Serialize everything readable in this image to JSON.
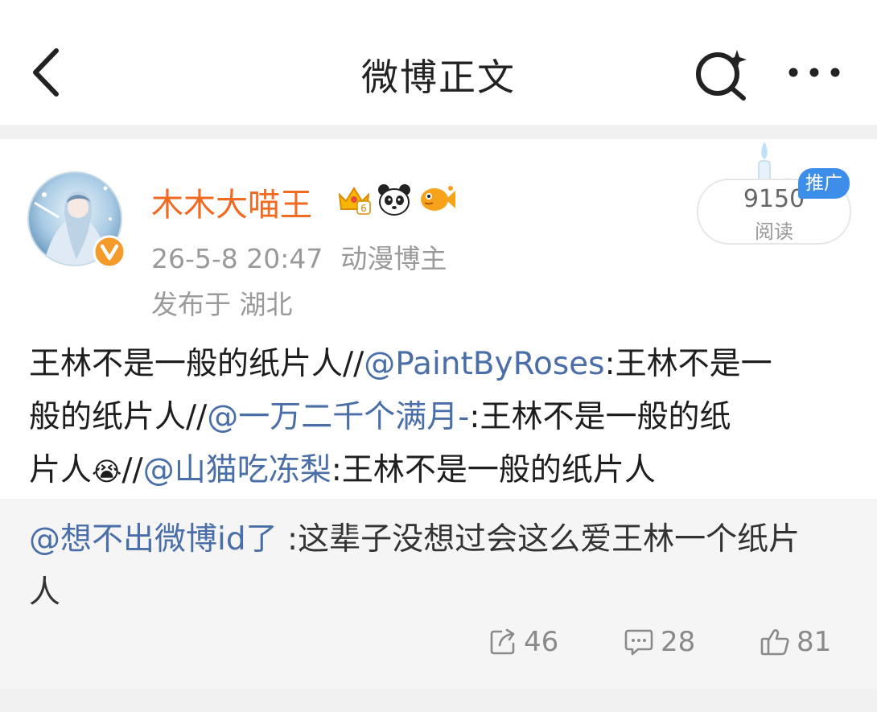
{
  "header": {
    "title": "微博正文"
  },
  "post": {
    "username": "木木大喵王",
    "datetime": "26-5-8 20:47",
    "source": "动漫博主",
    "location": "发布于 湖北",
    "read_count": "9150",
    "read_label": "阅读",
    "promo_badge": "推广",
    "badge_icons": [
      "crown-level-badge",
      "panda-badge",
      "fish-badge"
    ],
    "verified_icon": "verified-v-icon",
    "text": {
      "segment1": "王林不是一般的纸片人//",
      "mention1": "@PaintByRoses",
      "segment2a": ":王林不是一",
      "segment2b": "般的纸片人//",
      "mention2": "@一万二千个满月-",
      "segment3a": ":王林不是一般的纸",
      "segment3b": "片人",
      "emoji": "😭",
      "segment3c": "//",
      "mention3": "@山猫吃冻梨",
      "segment4": ":王林不是一般的纸片人"
    }
  },
  "quote": {
    "mention": "@想不出微博id了",
    "text_line1": " :这辈子没想过会这么爱王林一个纸片",
    "text_line2": "人"
  },
  "actions": {
    "repost_count": "46",
    "comment_count": "28",
    "like_count": "81"
  },
  "colors": {
    "username": "#f06a22",
    "mention": "#4a6fa8",
    "meta": "#9a9a9a",
    "promo": "#3c8ee8",
    "quote_bg": "#f5f5f5"
  }
}
